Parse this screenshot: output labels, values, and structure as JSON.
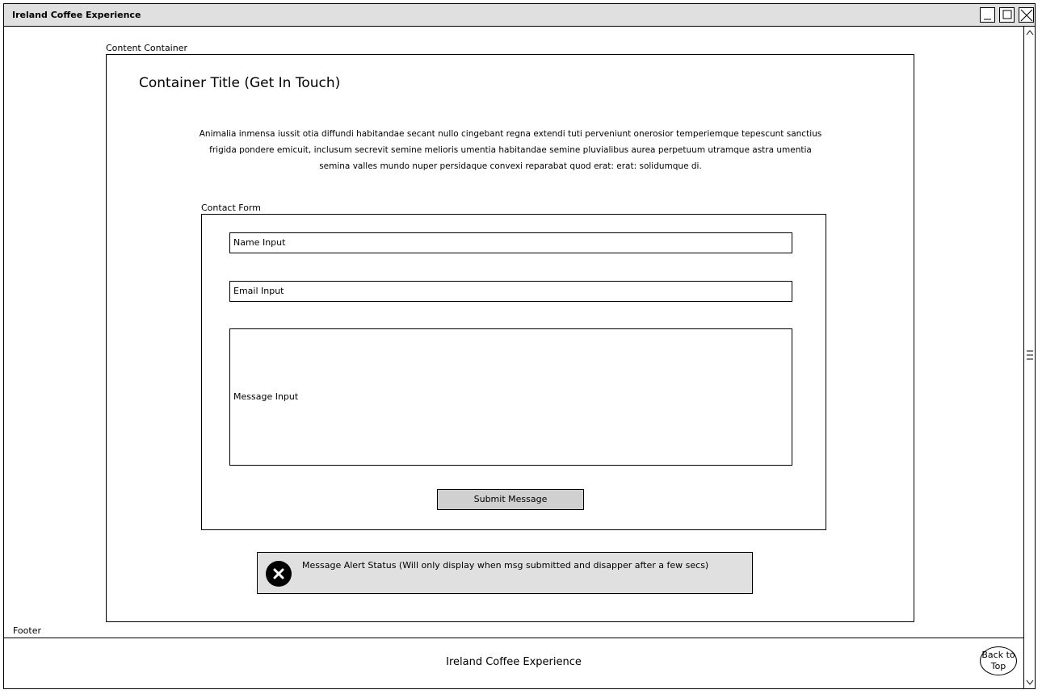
{
  "window": {
    "title": "Ireland Coffee Experience"
  },
  "content": {
    "container_label": "Content Container",
    "title": "Container Title (Get In Touch)",
    "description": "Animalia inmensa iussit otia diffundi habitandae secant nullo cingebant regna extendi tuti perveniunt onerosior temperiemque tepescunt sanctius frigida pondere emicuit, inclusum secrevit semine melioris umentia habitandae semine pluvialibus aurea perpetuum utramque astra umentia semina valles mundo nuper persidaque convexi reparabat quod erat: erat: solidumque di."
  },
  "form": {
    "label": "Contact Form",
    "name_placeholder": "Name Input",
    "email_placeholder": "Email Input",
    "message_placeholder": "Message Input",
    "submit_label": "Submit Message"
  },
  "alert": {
    "text": "Message Alert Status (Will only display when msg submitted and disapper after a few secs)",
    "icon": "close-circle-icon"
  },
  "footer": {
    "label": "Footer",
    "text": "Ireland Coffee Experience",
    "back_to_top": "Back to Top"
  }
}
